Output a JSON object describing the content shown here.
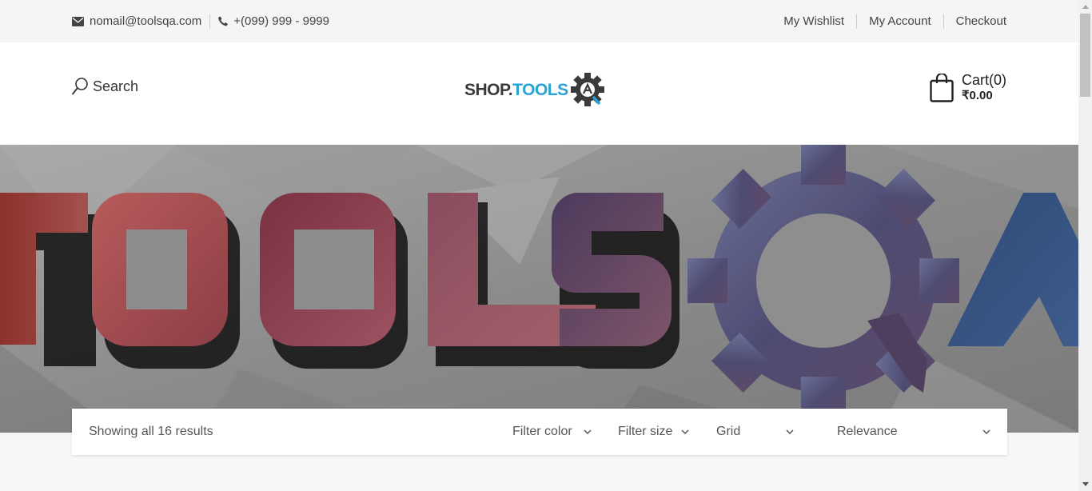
{
  "topbar": {
    "email": "nomail@toolsqa.com",
    "phone": "+(099) 999 - 9999",
    "links": [
      "My Wishlist",
      "My Account",
      "Checkout"
    ]
  },
  "header": {
    "search_label": "Search",
    "logo_text_dark": "SHOP.",
    "logo_text_blue": "TOOLS",
    "cart_label": "Cart(0)",
    "cart_total": "₹0.00"
  },
  "banner": {
    "text": "TOOLSQA"
  },
  "toolbar": {
    "results": "Showing all 16 results",
    "filter_color": "Filter color",
    "filter_size": "Filter size",
    "view": "Grid",
    "sort": "Relevance"
  },
  "colors": {
    "accent_blue": "#27a3d8",
    "topbar_bg": "#f5f5f5",
    "banner_bg": "#8f8f8f"
  },
  "icons": [
    "envelope-icon",
    "phone-icon",
    "search-icon",
    "gear-logo-icon",
    "shopping-bag-icon",
    "chevron-down-icon"
  ]
}
